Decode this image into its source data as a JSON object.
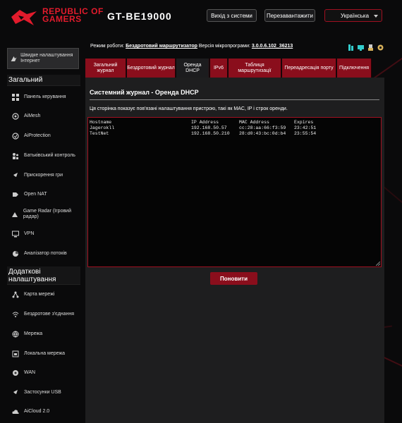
{
  "header": {
    "brand_line1": "REPUBLIC OF",
    "brand_line2": "GAMERS",
    "model": "GT-BE19000",
    "logout_label": "Вихід з системи",
    "reboot_label": "Перезавантажити",
    "language": "Українська"
  },
  "sidebar": {
    "quick_setup": "Швидке налаштування Інтернет",
    "general_title": "Загальний",
    "general_items": [
      {
        "label": "Панель керування",
        "icon": "dashboard-icon"
      },
      {
        "label": "AiMesh",
        "icon": "aimesh-icon"
      },
      {
        "label": "AiProtection",
        "icon": "aiprotection-icon"
      },
      {
        "label": "Батьківський контроль",
        "icon": "parental-control-icon"
      },
      {
        "label": "Прискорення гри",
        "icon": "game-boost-icon"
      },
      {
        "label": "Open NAT",
        "icon": "open-nat-icon"
      },
      {
        "label": "Game Radar (Ігровий радар)",
        "icon": "game-radar-icon"
      },
      {
        "label": "VPN",
        "icon": "vpn-icon"
      },
      {
        "label": "Аналізатор потоків",
        "icon": "traffic-analyzer-icon"
      }
    ],
    "advanced_title": "Додаткові налаштування",
    "advanced_items": [
      {
        "label": "Карта мережі",
        "icon": "network-map-icon"
      },
      {
        "label": "Бездротове з'єднання",
        "icon": "wireless-icon"
      },
      {
        "label": "Мережа",
        "icon": "network-icon"
      },
      {
        "label": "Локальна мережа",
        "icon": "lan-icon"
      },
      {
        "label": "WAN",
        "icon": "wan-icon"
      },
      {
        "label": "Застосунки USB",
        "icon": "usb-icon"
      },
      {
        "label": "AiCloud 2.0",
        "icon": "aicloud-icon"
      }
    ]
  },
  "info": {
    "mode_label": "Режим роботи:",
    "mode_value": "Бездротовий маршрутизатор",
    "fw_label": "Версія мікропрограми:",
    "fw_value": "3.0.0.6.102_36213"
  },
  "tabs": [
    {
      "label": "Загальний журнал"
    },
    {
      "label": "Бездротовий журнал"
    },
    {
      "label": "Оренда DHCP"
    },
    {
      "label": "IPv6"
    },
    {
      "label": "Таблиця маршрутизації"
    },
    {
      "label": "Переадресація порту"
    },
    {
      "label": "Підключення"
    }
  ],
  "content": {
    "title": "Системний журнал - Оренда DHCP",
    "description": "Ця сторінка показує пов'язані налаштування пристрою, такі як MAC, IP і строк оренди.",
    "table_headers": [
      "Hostname",
      "IP Address",
      "MAC Address",
      "Expires"
    ],
    "rows": [
      [
        "Jagerokll",
        "192.168.50.57",
        "cc:28:aa:66:f3:59",
        "23:42:51"
      ],
      [
        "TestNet",
        "192.168.50.210",
        "28:d0:43:bc:0d:b4",
        "23:55:54"
      ]
    ],
    "refresh_label": "Поновити"
  },
  "colors": {
    "accent": "#8a0e1c",
    "brand_red": "#e21b2c",
    "background": "#0a0a0b"
  }
}
